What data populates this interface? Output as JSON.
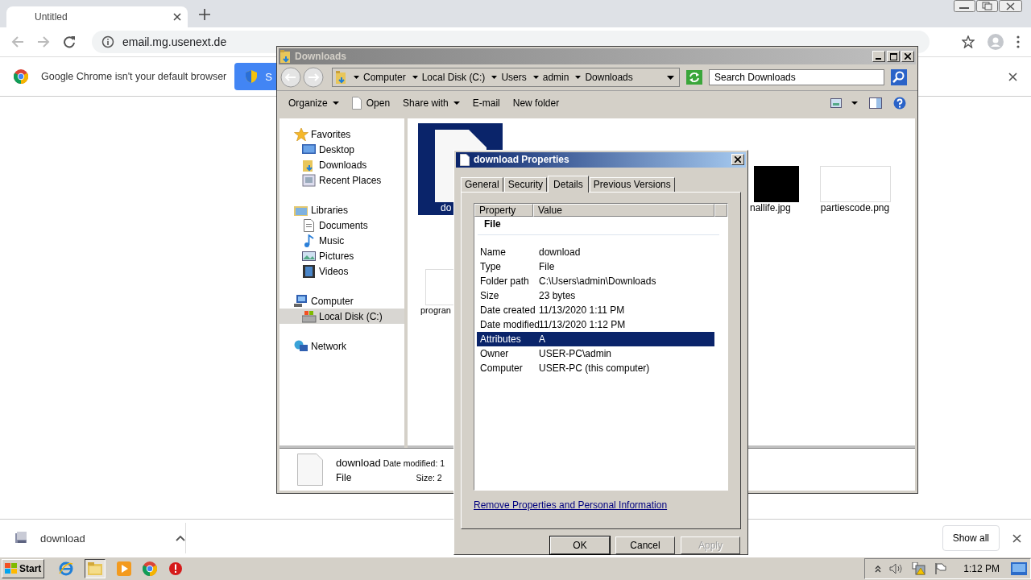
{
  "browser": {
    "tab_title": "Untitled",
    "url": "email.mg.usenext.de",
    "infobar": {
      "message": "Google Chrome isn't your default browser",
      "button": "S"
    },
    "download_bar": {
      "file": "download",
      "show_all": "Show all"
    }
  },
  "explorer": {
    "title": "Downloads",
    "breadcrumb": [
      "Computer",
      "Local Disk (C:)",
      "Users",
      "admin",
      "Downloads"
    ],
    "search": {
      "placeholder": "Search Downloads"
    },
    "toolbar": [
      {
        "label": "Organize",
        "dropdown": true,
        "kind": "plain"
      },
      {
        "label": "Open",
        "dropdown": false,
        "kind": "file"
      },
      {
        "label": "Share with",
        "dropdown": true,
        "kind": "plain"
      },
      {
        "label": "E-mail",
        "dropdown": false,
        "kind": "plain"
      },
      {
        "label": "New folder",
        "dropdown": false,
        "kind": "plain"
      }
    ],
    "nav": [
      {
        "label": "Favorites",
        "kind": "star",
        "selected": false,
        "children": [
          {
            "label": "Desktop",
            "kind": "monitor",
            "selected": false
          },
          {
            "label": "Downloads",
            "kind": "folder",
            "selected": false
          },
          {
            "label": "Recent Places",
            "kind": "recent",
            "selected": false
          }
        ]
      },
      {
        "label": "Libraries",
        "kind": "library",
        "selected": false,
        "children": [
          {
            "label": "Documents",
            "kind": "document",
            "selected": false
          },
          {
            "label": "Music",
            "kind": "note",
            "selected": false
          },
          {
            "label": "Pictures",
            "kind": "picture",
            "selected": false
          },
          {
            "label": "Videos",
            "kind": "film",
            "selected": false
          }
        ]
      },
      {
        "label": "Computer",
        "kind": "computer",
        "selected": false,
        "children": [
          {
            "label": "Local Disk (C:)",
            "kind": "disk",
            "selected": true
          }
        ]
      },
      {
        "label": "Network",
        "kind": "network",
        "selected": false
      }
    ],
    "files": [
      {
        "name": "do",
        "kind": "document",
        "selected": true
      },
      {
        "name": "nallife.jpg",
        "kind": "dark",
        "selected": false
      },
      {
        "name": "partiescode.png",
        "kind": "blank",
        "selected": false
      },
      {
        "name": "progran",
        "kind": "blank",
        "selected": false
      }
    ],
    "details": {
      "name": "download",
      "type": "File",
      "modified": "Date modified: 1",
      "size": "Size: 2"
    }
  },
  "dialog": {
    "title": "download Properties",
    "tabs": [
      {
        "label": "General",
        "selected": false
      },
      {
        "label": "Security",
        "selected": false
      },
      {
        "label": "Details",
        "selected": true
      },
      {
        "label": "Previous Versions",
        "selected": false
      }
    ],
    "columns": [
      "Property",
      "Value"
    ],
    "section": "File",
    "rows": [
      {
        "property": "Name",
        "value": "download",
        "selected": false
      },
      {
        "property": "Type",
        "value": "File",
        "selected": false
      },
      {
        "property": "Folder path",
        "value": "C:\\Users\\admin\\Downloads",
        "selected": false
      },
      {
        "property": "Size",
        "value": "23 bytes",
        "selected": false
      },
      {
        "property": "Date created",
        "value": "11/13/2020 1:11 PM",
        "selected": false
      },
      {
        "property": "Date modified",
        "value": "11/13/2020 1:12 PM",
        "selected": false
      },
      {
        "property": "Attributes",
        "value": "A",
        "selected": true
      },
      {
        "property": "Owner",
        "value": "USER-PC\\admin",
        "selected": false
      },
      {
        "property": "Computer",
        "value": "USER-PC (this computer)",
        "selected": false
      }
    ],
    "link": "Remove Properties and Personal Information",
    "buttons": [
      {
        "label": "OK",
        "disabled": false,
        "default": true
      },
      {
        "label": "Cancel",
        "disabled": false,
        "default": false
      },
      {
        "label": "Apply",
        "disabled": true,
        "default": false
      }
    ]
  },
  "taskbar": {
    "start": "Start",
    "clock": "1:12 PM"
  }
}
